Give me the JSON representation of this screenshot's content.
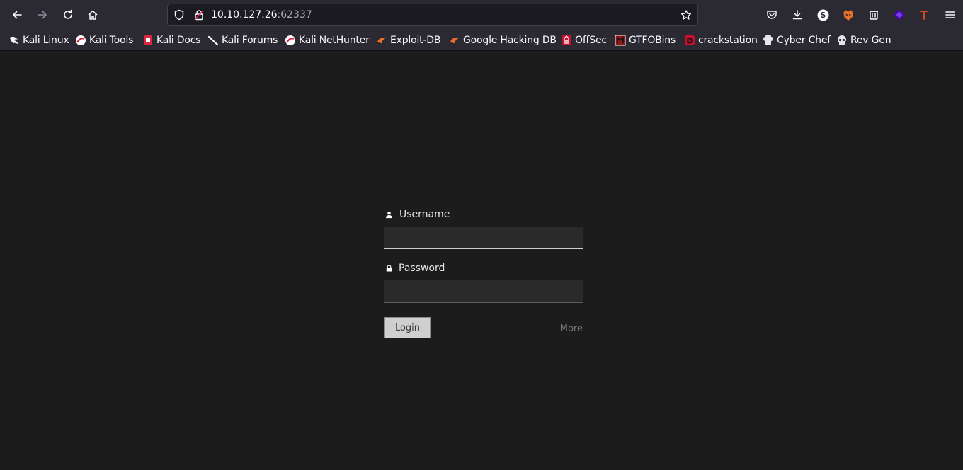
{
  "browser": {
    "url_host": "10.10.127.26",
    "url_port": ":62337",
    "bookmarks": [
      {
        "label": "Kali Linux",
        "icon": "kali-dragon-icon"
      },
      {
        "label": "Kali Tools",
        "icon": "kali-tools-icon"
      },
      {
        "label": "Kali Docs",
        "icon": "kali-docs-icon"
      },
      {
        "label": "Kali Forums",
        "icon": "kali-forums-icon"
      },
      {
        "label": "Kali NetHunter",
        "icon": "kali-nethunter-icon"
      },
      {
        "label": "Exploit-DB",
        "icon": "exploit-db-icon"
      },
      {
        "label": "Google Hacking DB",
        "icon": "ghdb-icon"
      },
      {
        "label": "OffSec",
        "icon": "offsec-icon"
      },
      {
        "label": "GTFOBins",
        "icon": "gtfobins-icon"
      },
      {
        "label": "crackstation",
        "icon": "crackstation-icon"
      },
      {
        "label": "Cyber Chef",
        "icon": "cyberchef-icon"
      },
      {
        "label": "Rev Gen",
        "icon": "skull-icon"
      }
    ]
  },
  "login": {
    "username_label": "Username",
    "username_value": "",
    "password_label": "Password",
    "password_value": "",
    "login_button": "Login",
    "more_link": "More"
  },
  "colors": {
    "chrome": "#2b2a33",
    "page_bg": "#1c1c1c",
    "input_bg": "#2a2a2a",
    "button_bg": "#cfcfcf"
  }
}
